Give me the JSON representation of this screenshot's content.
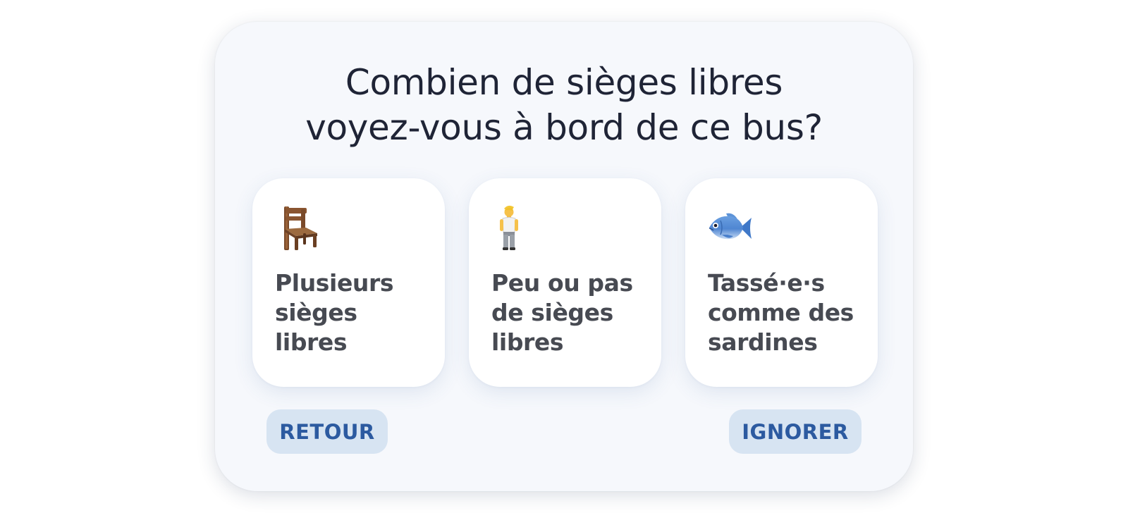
{
  "question": {
    "line1": "Combien de sièges libres",
    "line2": "voyez-vous à bord de ce bus?"
  },
  "options": [
    {
      "icon": "chair-icon",
      "lines": [
        "Plusieurs",
        "sièges",
        "libres"
      ]
    },
    {
      "icon": "standing-person-icon",
      "lines": [
        "Peu ou pas",
        "de sièges",
        "libres"
      ]
    },
    {
      "icon": "fish-icon",
      "lines": [
        "Tassé·e·s",
        "comme des",
        "sardines"
      ]
    }
  ],
  "buttons": {
    "back_label": "RETOUR",
    "skip_label": "IGNORER"
  },
  "colors": {
    "panel_background": "#f6f8fc",
    "card_background": "#ffffff",
    "title_text": "#1f2436",
    "option_text": "#474a52",
    "button_background": "#d7e4f2",
    "button_text": "#2c5aa0"
  }
}
